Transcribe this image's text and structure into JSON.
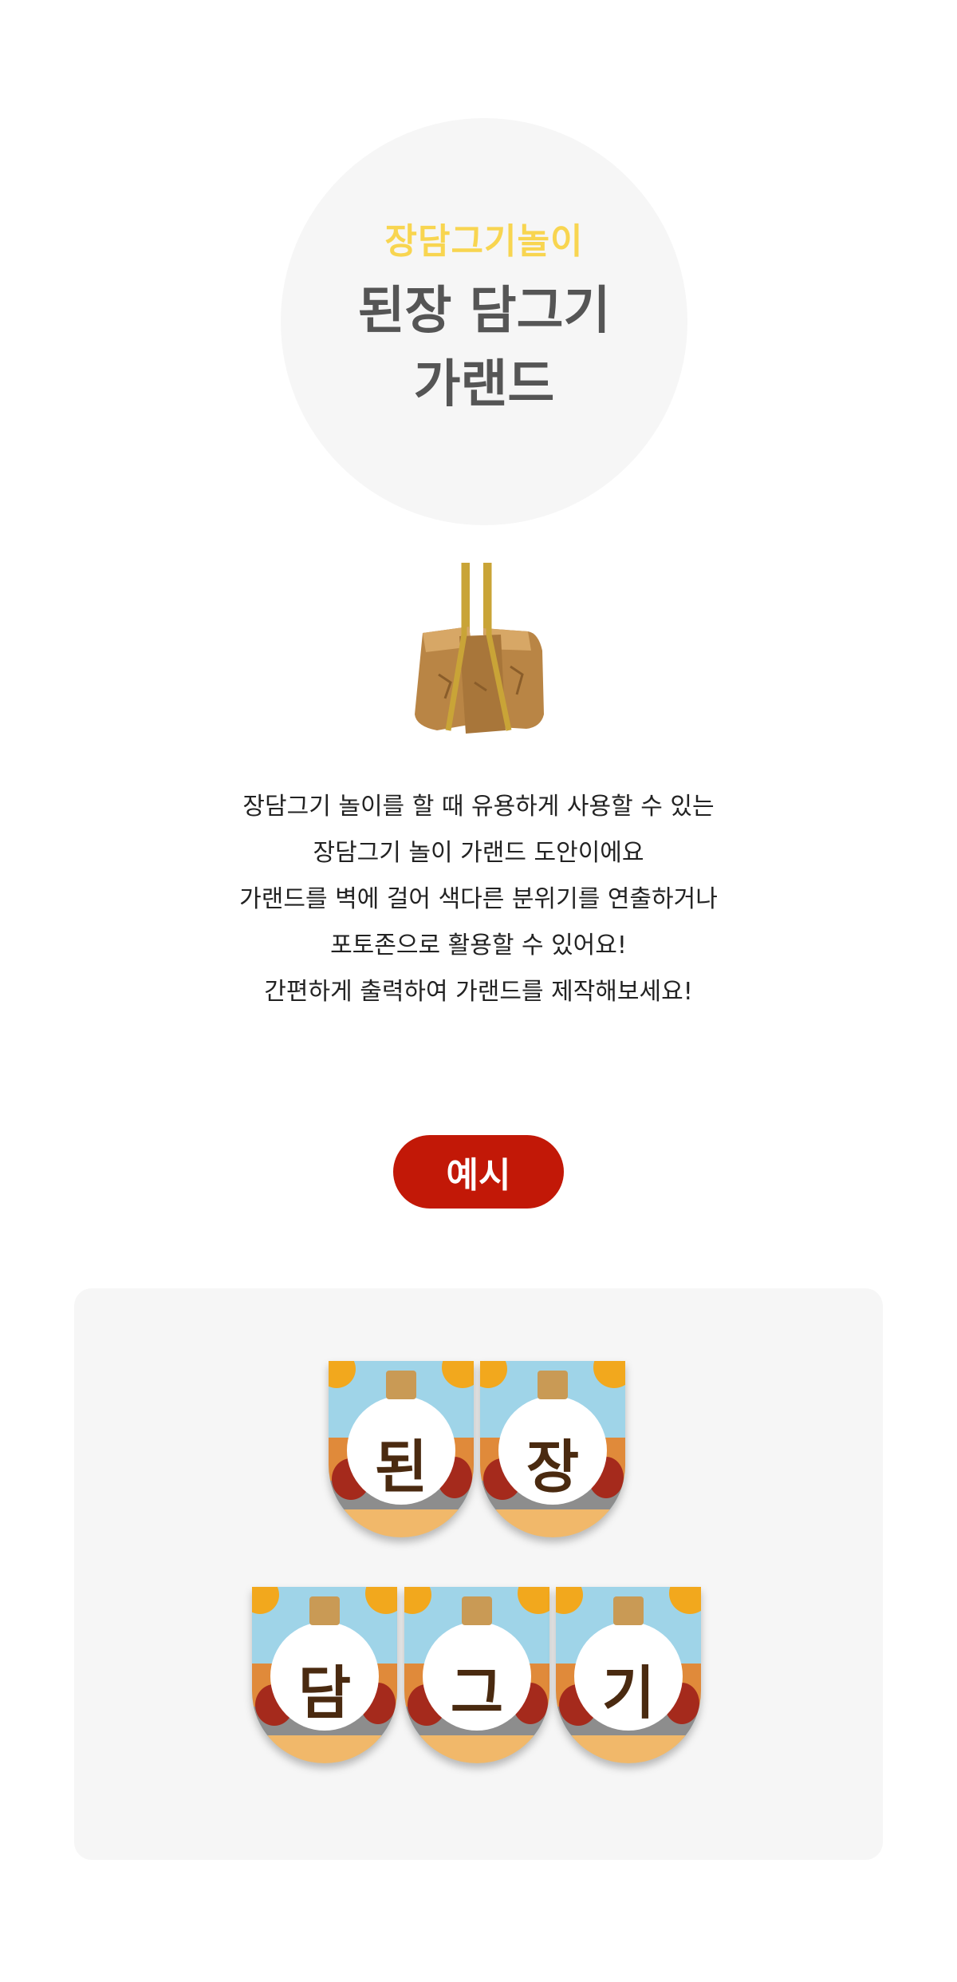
{
  "hero": {
    "subtitle": "장담그기놀이",
    "title_line1": "된장 담그기",
    "title_line2": "가랜드"
  },
  "illustration": {
    "icon": "meju-icon"
  },
  "description": {
    "lines": [
      "장담그기 놀이를 할 때 유용하게 사용할 수 있는",
      "장담그기 놀이 가랜드 도안이에요",
      "가랜드를 벽에 걸어 색다른 분위기를 연출하거나",
      "포토존으로 활용할 수 있어요!",
      "간편하게 출력하여 가랜드를 제작해보세요!"
    ]
  },
  "example_button": {
    "label": "예시"
  },
  "garland": {
    "row1": [
      "된",
      "장"
    ],
    "row2": [
      "담",
      "그",
      "기"
    ]
  },
  "colors": {
    "accent_yellow": "#f8d550",
    "title_gray": "#555555",
    "button_red": "#c21807",
    "panel_bg": "#f6f6f6"
  }
}
